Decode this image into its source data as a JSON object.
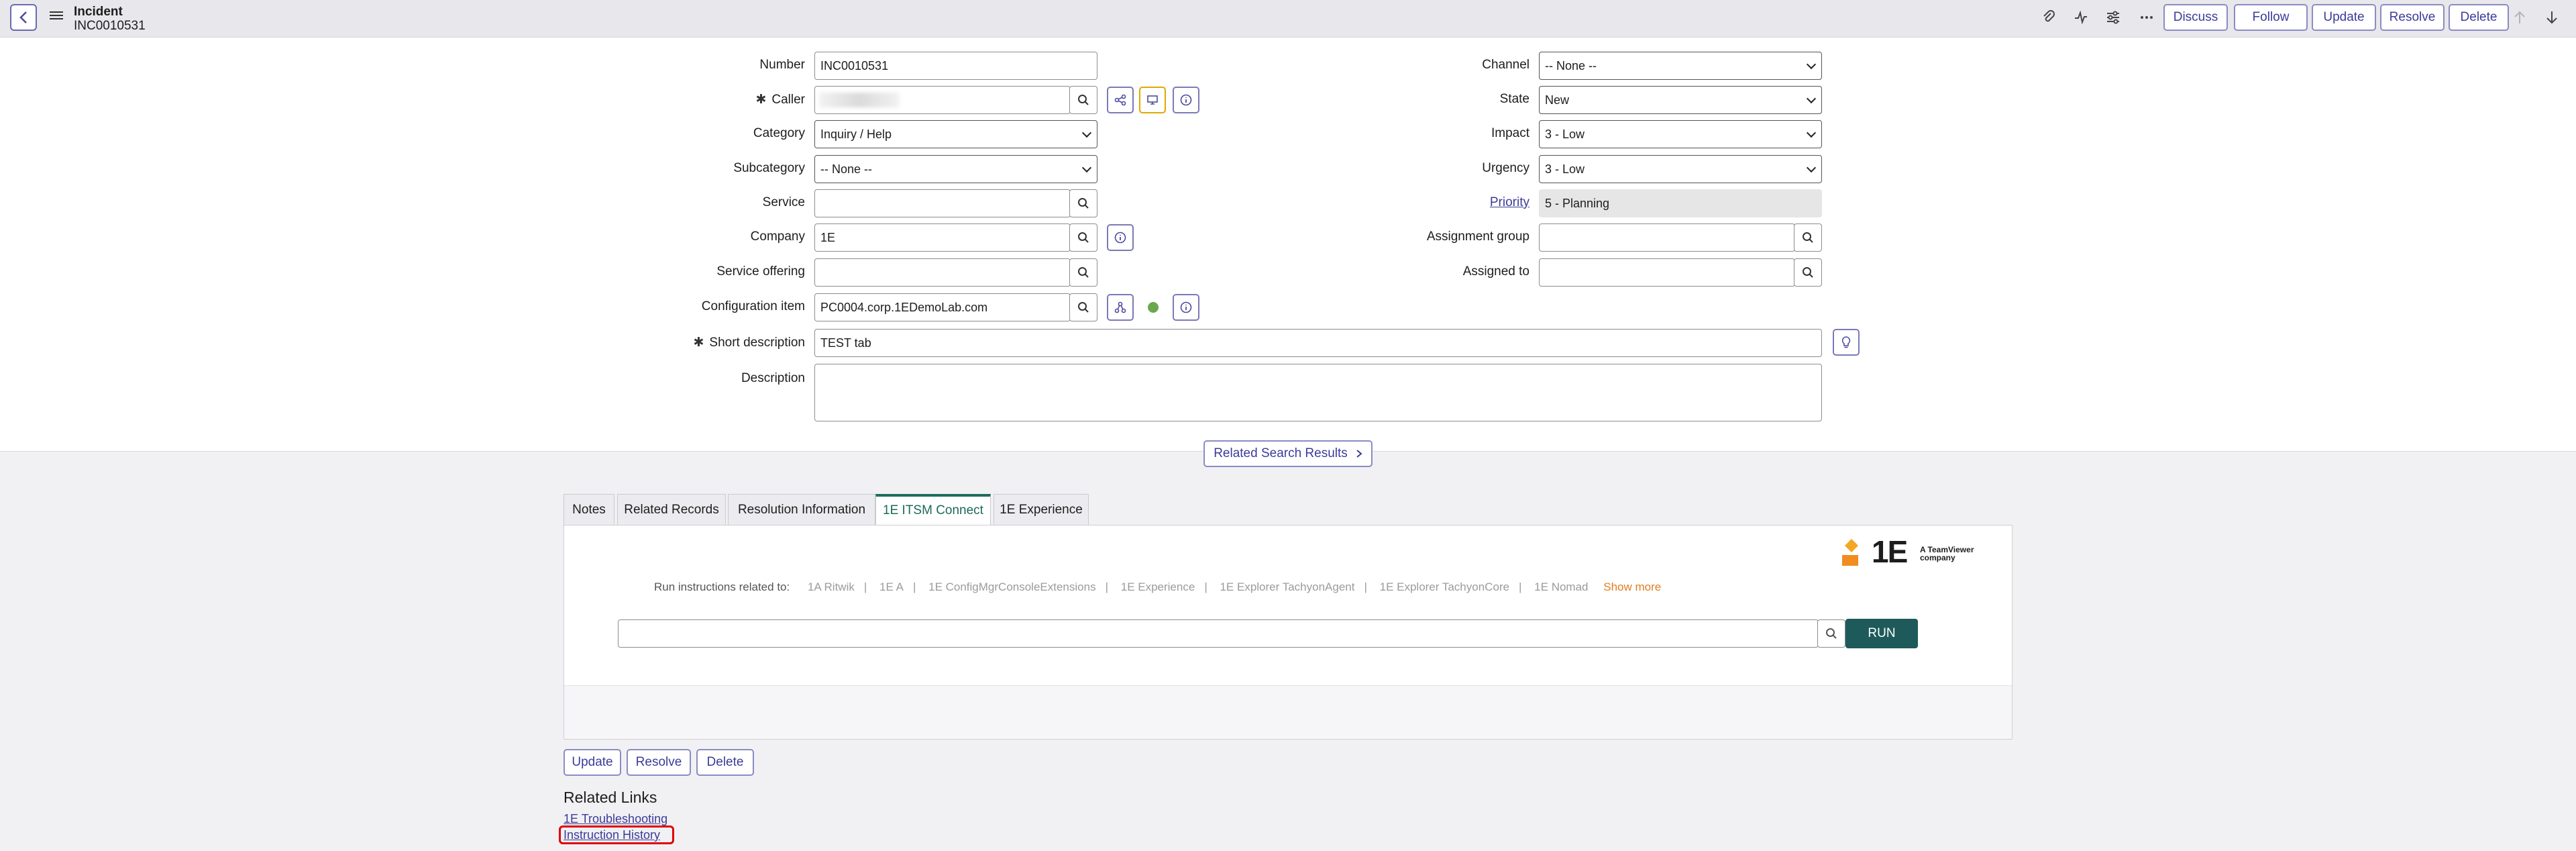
{
  "header": {
    "record_type": "Incident",
    "record_number": "INC0010531",
    "buttons": {
      "discuss": "Discuss",
      "follow": "Follow",
      "update": "Update",
      "resolve": "Resolve",
      "delete": "Delete"
    },
    "icons": [
      "back-icon",
      "menu-icon",
      "paperclip-icon",
      "activity-icon",
      "settings-sliders-icon",
      "more-icon",
      "arrow-up-icon",
      "arrow-down-icon"
    ]
  },
  "form": {
    "number": {
      "label": "Number",
      "value": "INC0010531"
    },
    "caller": {
      "label": "Caller",
      "value": ""
    },
    "category": {
      "label": "Category",
      "value": "Inquiry / Help"
    },
    "subcategory": {
      "label": "Subcategory",
      "value": "-- None --"
    },
    "service": {
      "label": "Service",
      "value": ""
    },
    "company": {
      "label": "Company",
      "value": "1E"
    },
    "service_offering": {
      "label": "Service offering",
      "value": ""
    },
    "configuration_item": {
      "label": "Configuration item",
      "value": "PC0004.corp.1EDemoLab.com"
    },
    "short_description": {
      "label": "Short description",
      "value": "TEST tab"
    },
    "description": {
      "label": "Description",
      "value": ""
    },
    "channel": {
      "label": "Channel",
      "value": "-- None --"
    },
    "state": {
      "label": "State",
      "value": "New"
    },
    "impact": {
      "label": "Impact",
      "value": "3 - Low"
    },
    "urgency": {
      "label": "Urgency",
      "value": "3 - Low"
    },
    "priority": {
      "label": "Priority",
      "value": "5 - Planning"
    },
    "assignment_group": {
      "label": "Assignment group",
      "value": ""
    },
    "assigned_to": {
      "label": "Assigned to",
      "value": ""
    }
  },
  "related_search": "Related Search Results",
  "tabs": [
    "Notes",
    "Related Records",
    "Resolution Information",
    "1E ITSM Connect",
    "1E Experience"
  ],
  "active_tab": "1E ITSM Connect",
  "itsm_connect": {
    "logo_text": "1E",
    "logo_tagline_1": "A TeamViewer",
    "logo_tagline_2": "company",
    "run_label": "Run instructions related to:",
    "products": [
      "1A Ritwik",
      "1E A",
      "1E ConfigMgrConsoleExtensions",
      "1E Experience",
      "1E Explorer TachyonAgent",
      "1E Explorer TachyonCore",
      "1E Nomad"
    ],
    "show_more": "Show more",
    "search_value": "",
    "run_button": "RUN"
  },
  "bottom_buttons": {
    "update": "Update",
    "resolve": "Resolve",
    "delete": "Delete"
  },
  "related_links": {
    "title": "Related Links",
    "items": [
      "1E Troubleshooting",
      "Instruction History"
    ]
  },
  "colors": {
    "accent": "#3b3b9a",
    "active_tab": "#1e6d5c",
    "run_button": "#1e5a5a",
    "highlight": "#e00000",
    "show_more": "#e07d1e",
    "status_dot": "#6aa84f"
  }
}
